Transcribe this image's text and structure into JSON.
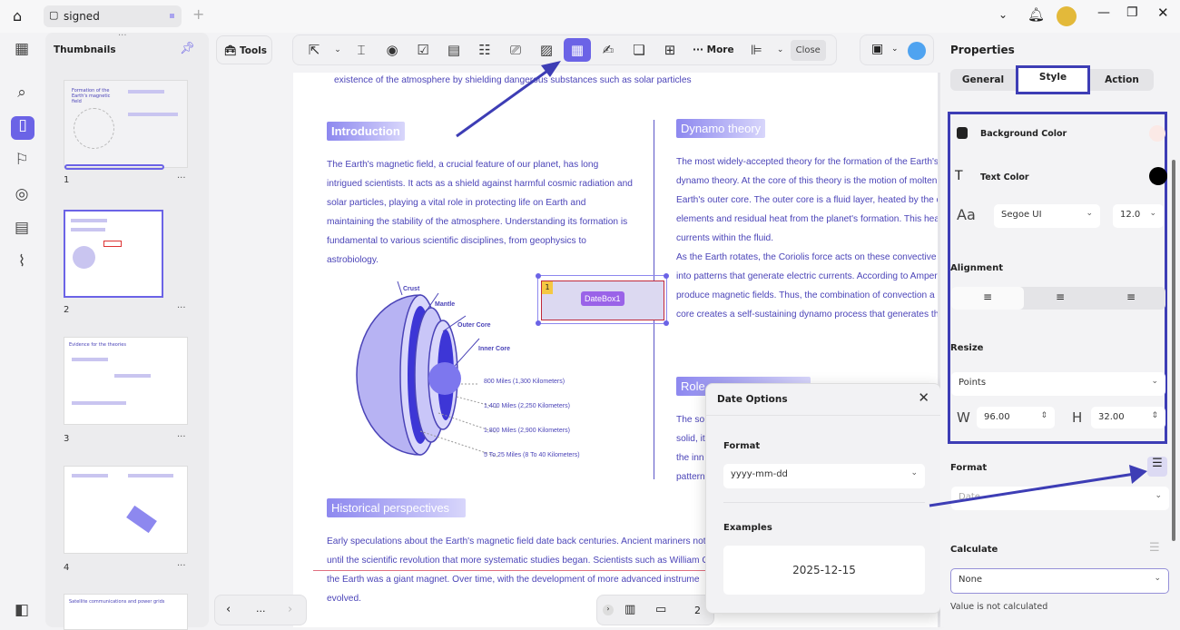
{
  "titlebar": {
    "tab_label": "signed"
  },
  "thumbnails": {
    "title": "Thumbnails",
    "pages": [
      "1",
      "2",
      "3",
      "4"
    ],
    "page_titles": [
      "Formation of the Earth's magnetic field",
      "",
      "Evidence for the theories",
      "",
      "Satellite communications and power grids"
    ]
  },
  "toolbar": {
    "tools_label": "Tools",
    "more_label": "More",
    "close_label": "Close"
  },
  "document": {
    "top_cut": "existence of the atmosphere by shielding dangerous substances such as solar particles",
    "intro_title": "Introduction",
    "intro_lines": [
      "The Earth's magnetic field, a crucial feature of our planet, has long",
      "intrigued scientists. It acts as a shield against harmful cosmic radiation and",
      " solar particles, playing a vital role in protecting life on Earth and",
      "maintaining the stability of the atmosphere. Understanding its formation is",
      "fundamental to various scientific disciplines, from geophysics to",
      "astrobiology."
    ],
    "dynamo_title": "Dynamo theory",
    "dynamo_lines": [
      "The most widely-accepted theory for the formation of the Earth's m",
      "dynamo theory. At the core of this theory is the motion of molten ir",
      "Earth's outer core. The outer core is a fluid layer, heated by the de",
      "elements and residual heat from the planet's formation. This heat",
      "currents within the fluid.",
      "As the Earth rotates, the Coriolis force acts on these convective",
      "into patterns that generate electric currents. According to Ampere",
      "produce magnetic fields. Thus, the combination of convection a",
      "core creates a self-sustaining dynamo process that generates the"
    ],
    "diagram_labels": [
      "Crust",
      "Mantle",
      "Outer Core",
      "Inner Core"
    ],
    "distances": [
      "800 Miles (1,300 Kilometers)",
      "1,400 Miles (2,250 Kilometers)",
      "1,800 Miles (2,900 Kilometers)",
      "5 To 25 Miles (8 To 40 Kilometers)"
    ],
    "datebox": {
      "badge": "1",
      "label": "DateBox1"
    },
    "role_title": "Role",
    "role_lines": [
      "The so",
      "solid, it",
      "the inn",
      "pattern"
    ],
    "hist_title": "Historical perspectives",
    "hist_lines": [
      "Early speculations about the Earth's magnetic field date back centuries. Ancient mariners notic",
      "until the scientific revolution that more systematic studies began. Scientists such as William Gil",
      "the Earth was a giant magnet. Over time, with the development of more advanced instrume",
      "evolved."
    ]
  },
  "bottom": {
    "dots": "...",
    "page": "2"
  },
  "date_options": {
    "title": "Date Options",
    "format_label": "Format",
    "format_value": "yyyy-mm-dd",
    "examples_label": "Examples",
    "example_value": "2025-12-15"
  },
  "properties": {
    "title": "Properties",
    "tabs": [
      "General",
      "Style",
      "Action"
    ],
    "background_color_label": "Background Color",
    "background_color": "#fbe9e6",
    "text_color_label": "Text Color",
    "text_color": "#000000",
    "font_family": "Segoe UI",
    "font_size": "12.0",
    "alignment_label": "Alignment",
    "resize_label": "Resize",
    "resize_unit": "Points",
    "w_label": "W",
    "w_value": "96.00",
    "h_label": "H",
    "h_value": "32.00",
    "format_label": "Format",
    "format_value": "Date",
    "calculate_label": "Calculate",
    "calculate_value": "None",
    "calculate_note": "Value is not calculated"
  },
  "colors": {
    "accent": "#6b63e6",
    "annotation": "#3d3db5",
    "doc_text": "#4b44b8"
  }
}
